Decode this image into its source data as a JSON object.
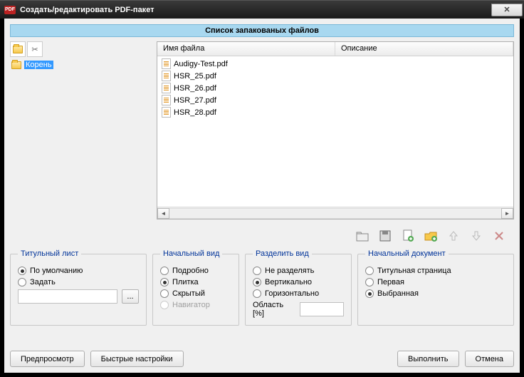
{
  "window": {
    "title": "Создать/редактировать PDF-пакет"
  },
  "banner": "Список запакованых файлов",
  "tree": {
    "root": "Корень"
  },
  "list": {
    "cols": {
      "name": "Имя файла",
      "desc": "Описание"
    },
    "files": [
      "Audigy-Test.pdf",
      "HSR_25.pdf",
      "HSR_26.pdf",
      "HSR_27.pdf",
      "HSR_28.pdf"
    ]
  },
  "groups": {
    "title_page": {
      "legend": "Титульный лист",
      "default": "По умолчанию",
      "set": "Задать",
      "browse": "..."
    },
    "initial_view": {
      "legend": "Начальный вид",
      "detail": "Подробно",
      "tile": "Плитка",
      "hidden": "Скрытый",
      "navigator": "Навигатор"
    },
    "split_view": {
      "legend": "Разделить вид",
      "none": "Не разделять",
      "vert": "Вертикально",
      "horiz": "Горизонтально",
      "area": "Область [%]"
    },
    "initial_doc": {
      "legend": "Начальный документ",
      "cover": "Титульная страница",
      "first": "Первая",
      "selected": "Выбранная"
    }
  },
  "buttons": {
    "preview": "Предпросмотр",
    "quick": "Быстрые настройки",
    "ok": "Выполнить",
    "cancel": "Отмена"
  }
}
